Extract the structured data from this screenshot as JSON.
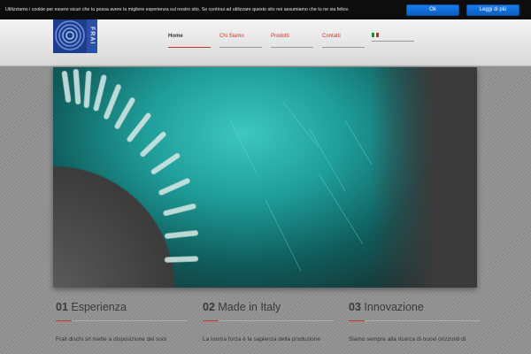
{
  "cookie": {
    "text": "Utilizziamo i cookie per essere sicuri che tu possa avere la migliore esperienza sul nostro sito. Se continui ad utilizzare questo sito noi assumiamo che tu ne sia felice.",
    "ok_label": "Ok",
    "more_label": "Leggi di più"
  },
  "header": {
    "logo_word": "FRAI",
    "nav": [
      {
        "label": "Home"
      },
      {
        "label": "Chi Siamo"
      },
      {
        "label": "Prodotti"
      },
      {
        "label": "Contatti"
      }
    ],
    "language_flag": "italy-flag-icon"
  },
  "features": [
    {
      "number": "01",
      "title": "Esperienza",
      "text": "Frail dischi srl mette a disposizione dei suoi"
    },
    {
      "number": "02",
      "title": "Made in Italy",
      "text": "La nostra forza è la sapienza della produzione"
    },
    {
      "number": "03",
      "title": "Innovazione",
      "text": "Siamo sempre alla ricerca di nuovi orizzonti di"
    }
  ],
  "colors": {
    "accent": "#c0392b",
    "button_blue": "#0a5fc4",
    "cookie_bar": "#0d0d0d"
  }
}
